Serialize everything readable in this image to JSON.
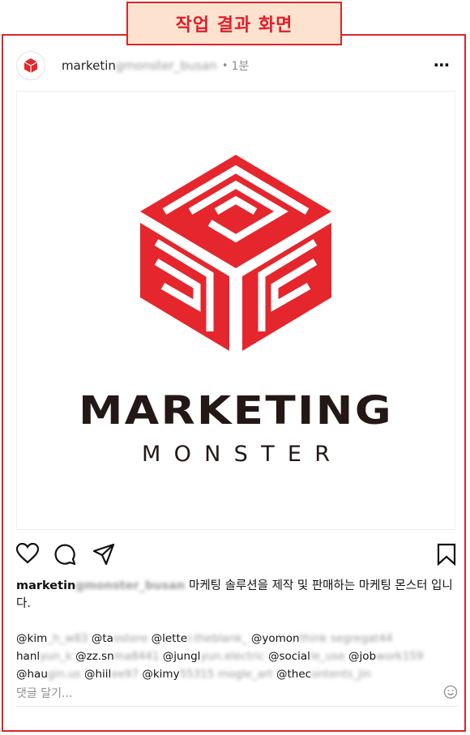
{
  "badge": {
    "title": "작업 결과 화면"
  },
  "post": {
    "username_visible": "marketin",
    "username_blurred": "gmonster_busan",
    "dot": "•",
    "time": "1분",
    "more_icon": "⋯",
    "image": {
      "logo_word": "MARKETING",
      "logo_sub": "MONSTER",
      "brand_color": "#e5262d",
      "text_color": "#231815"
    },
    "caption": {
      "user_visible": "marketin",
      "user_blurred": "gmonster_busan",
      "text": "마케팅 솔루션을 제작 및 판매하는 마케팅 몬스터 입니다."
    },
    "tags": [
      {
        "visible": "@kim",
        "blurred": "_h_w83"
      },
      {
        "visible": "@ta",
        "blurred": "ostere"
      },
      {
        "visible": "@lette",
        "blurred": "r.theblank_"
      },
      {
        "visible": "@yomon",
        "blurred": "think segregat44"
      },
      {
        "visible": "hanl",
        "blurred": "yun_k"
      },
      {
        "visible": "@zz.sn",
        "blurred": "ma8441"
      },
      {
        "visible": "@jungl",
        "blurred": "yun.electric"
      },
      {
        "visible": "@social",
        "blurred": "le_use"
      },
      {
        "visible": "@job",
        "blurred": "work159"
      },
      {
        "visible": "@hau",
        "blurred": "gin.us"
      },
      {
        "visible": "@hiil",
        "blurred": "ee97"
      },
      {
        "visible": "@kimy",
        "blurred": "55315 mogle_art"
      },
      {
        "visible": "@thec",
        "blurred": "ontents_jin"
      }
    ],
    "comment_placeholder": "댓글 달기..."
  }
}
